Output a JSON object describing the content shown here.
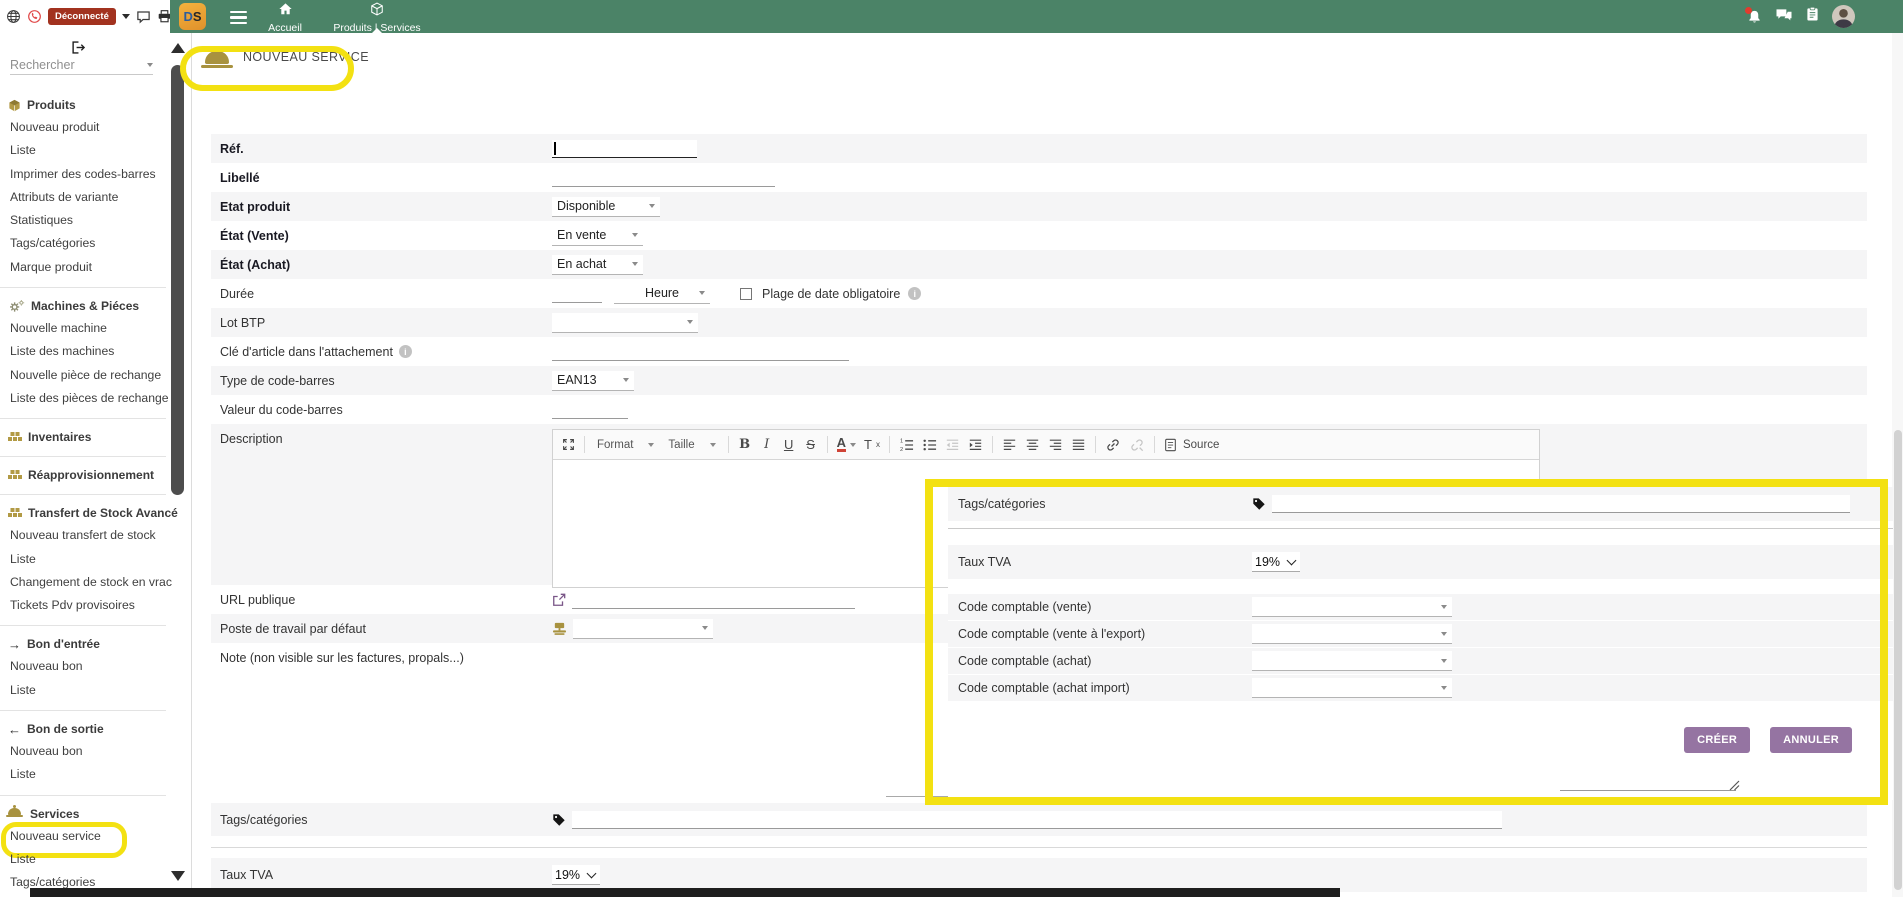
{
  "glyphs": {
    "help": "?",
    "info": "i"
  },
  "browser_strip": {
    "disconnected_label": "Déconnecté"
  },
  "topbar": {
    "logo_text": "DS",
    "menu": [
      {
        "label": "Accueil",
        "icon": "home-icon"
      },
      {
        "label": "Produits | Services",
        "icon": "cube-icon",
        "active": true
      }
    ]
  },
  "sidebar": {
    "search_placeholder": "Rechercher",
    "sections": [
      {
        "title": "Produits",
        "icon": "cube-gold-icon",
        "items": [
          "Nouveau produit",
          "Liste",
          "Imprimer des codes-barres",
          "Attributs de variante",
          "Statistiques",
          "Tags/catégories",
          "Marque produit"
        ]
      },
      {
        "title": "Machines & Piéces",
        "icon": "gears-icon",
        "items": [
          "Nouvelle machine",
          "Liste des machines",
          "Nouvelle pièce de rechange",
          "Liste des pièces de rechange"
        ]
      },
      {
        "title": "Inventaires",
        "icon": "pallet-icon",
        "items": []
      },
      {
        "title": "Réapprovisionnement",
        "icon": "pallet-icon",
        "items": []
      },
      {
        "title": "Transfert de Stock Avancé",
        "icon": "pallet-icon",
        "items": [
          "Nouveau transfert de stock",
          "Liste",
          "Changement de stock en vrac",
          "Tickets Pdv provisoires"
        ]
      },
      {
        "title": "Bon d'entrée",
        "icon": "arrow-right-icon",
        "items": [
          "Nouveau bon",
          "Liste"
        ]
      },
      {
        "title": "Bon de sortie",
        "icon": "arrow-left-icon",
        "items": [
          "Nouveau bon",
          "Liste"
        ]
      },
      {
        "title": "Services",
        "icon": "dome-icon",
        "items": [
          "Nouveau service",
          "Liste",
          "Tags/catégories"
        ],
        "highlight_item": "Nouveau service"
      }
    ]
  },
  "page": {
    "title": "NOUVEAU SERVICE"
  },
  "form": {
    "rows": [
      {
        "label": "Réf.",
        "bold": true,
        "control": {
          "type": "input",
          "focused": true,
          "value": ""
        }
      },
      {
        "label": "Libellé",
        "bold": true,
        "control": {
          "type": "input",
          "value": ""
        }
      },
      {
        "label": "Etat produit",
        "bold": true,
        "control": {
          "type": "select",
          "value": "Disponible"
        }
      },
      {
        "label": "État (Vente)",
        "bold": true,
        "control": {
          "type": "select",
          "value": "En vente"
        }
      },
      {
        "label": "État (Achat)",
        "bold": true,
        "control": {
          "type": "select",
          "value": "En achat"
        }
      },
      {
        "label": "Durée",
        "control": {
          "type": "duration",
          "input_value": "",
          "select_value": "Heure",
          "checkbox_label": "Plage de date obligatoire",
          "checkbox_checked": false,
          "info": true
        }
      },
      {
        "label": "Lot BTP",
        "control": {
          "type": "select",
          "value": ""
        }
      },
      {
        "label": "Clé d'article dans l'attachement",
        "info": true,
        "control": {
          "type": "input",
          "value": ""
        }
      },
      {
        "label": "Type de code-barres",
        "control": {
          "type": "select",
          "value": "EAN13"
        }
      },
      {
        "label": "Valeur du code-barres",
        "control": {
          "type": "input",
          "value": ""
        }
      },
      {
        "label": "Description",
        "control": {
          "type": "editor",
          "value": ""
        }
      },
      {
        "label": "URL publique",
        "control": {
          "type": "icon-input",
          "icon": "external-link-icon",
          "value": ""
        }
      },
      {
        "label": "Poste de travail par défaut",
        "control": {
          "type": "icon-select",
          "icon": "workstation-icon",
          "value": ""
        }
      },
      {
        "label": "Note (non visible sur les factures, propals...)",
        "control": {
          "type": "note",
          "value": ""
        }
      },
      {
        "label": "Tags/catégories",
        "control": {
          "type": "tags",
          "value": ""
        }
      },
      {
        "label": "Taux TVA",
        "control": {
          "type": "vat",
          "value": "19%"
        }
      }
    ]
  },
  "editor_toolbar": [
    {
      "item": "maximize"
    },
    {
      "item": "format",
      "label": "Format"
    },
    {
      "item": "size",
      "label": "Taille"
    },
    {
      "item": "bold",
      "glyph": "B"
    },
    {
      "item": "italic",
      "glyph": "I"
    },
    {
      "item": "underline",
      "glyph": "U"
    },
    {
      "item": "strike",
      "glyph": "S"
    },
    {
      "item": "textcolor",
      "glyph": "A"
    },
    {
      "item": "removeformat",
      "glyph": "Tx"
    },
    {
      "item": "numlist"
    },
    {
      "item": "bullist"
    },
    {
      "item": "outdent",
      "disabled": true
    },
    {
      "item": "indent"
    },
    {
      "item": "align-left"
    },
    {
      "item": "align-center"
    },
    {
      "item": "align-right"
    },
    {
      "item": "justify"
    },
    {
      "item": "link"
    },
    {
      "item": "unlink",
      "disabled": true
    },
    {
      "item": "source",
      "label": "Source"
    }
  ],
  "overlay": {
    "rows": [
      {
        "label": "Tags/catégories",
        "control": {
          "type": "tags",
          "value": ""
        }
      },
      {
        "label": "Taux TVA",
        "control": {
          "type": "vat",
          "value": "19%"
        }
      },
      {
        "label": "Code comptable (vente)",
        "control": {
          "type": "select",
          "value": ""
        }
      },
      {
        "label": "Code comptable (vente à l'export)",
        "control": {
          "type": "select",
          "value": ""
        }
      },
      {
        "label": "Code comptable (achat)",
        "control": {
          "type": "select",
          "value": ""
        }
      },
      {
        "label": "Code comptable (achat import)",
        "control": {
          "type": "select",
          "value": ""
        }
      }
    ],
    "buttons": {
      "create": "CRÉER",
      "cancel": "ANNULER"
    }
  }
}
